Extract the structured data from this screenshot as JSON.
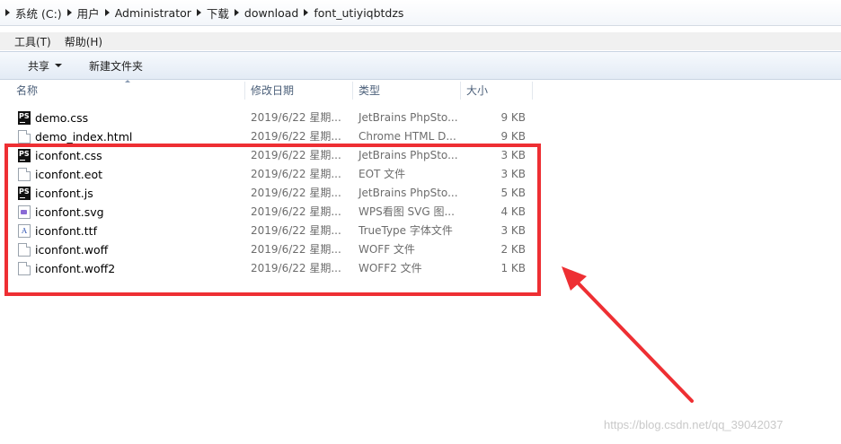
{
  "breadcrumb": [
    "系统 (C:)",
    "用户",
    "Administrator",
    "下载",
    "download",
    "font_utiyiqbtdzs"
  ],
  "menu": {
    "tools": "工具(T)",
    "help": "帮助(H)"
  },
  "toolbar": {
    "share": "共享",
    "new_folder": "新建文件夹"
  },
  "columns": {
    "name": "名称",
    "date": "修改日期",
    "type": "类型",
    "size": "大小"
  },
  "files": [
    {
      "name": "demo.css",
      "date": "2019/6/22 星期...",
      "type": "JetBrains PhpSto...",
      "size": "9 KB",
      "icon": "phpstorm-icon"
    },
    {
      "name": "demo_index.html",
      "date": "2019/6/22 星期...",
      "type": "Chrome HTML D...",
      "size": "9 KB",
      "icon": "file-icon"
    },
    {
      "name": "iconfont.css",
      "date": "2019/6/22 星期...",
      "type": "JetBrains PhpSto...",
      "size": "3 KB",
      "icon": "phpstorm-icon"
    },
    {
      "name": "iconfont.eot",
      "date": "2019/6/22 星期...",
      "type": "EOT 文件",
      "size": "3 KB",
      "icon": "file-icon"
    },
    {
      "name": "iconfont.js",
      "date": "2019/6/22 星期...",
      "type": "JetBrains PhpSto...",
      "size": "5 KB",
      "icon": "phpstorm-icon"
    },
    {
      "name": "iconfont.svg",
      "date": "2019/6/22 星期...",
      "type": "WPS看图 SVG 图...",
      "size": "4 KB",
      "icon": "svg-file-icon"
    },
    {
      "name": "iconfont.ttf",
      "date": "2019/6/22 星期...",
      "type": "TrueType 字体文件",
      "size": "3 KB",
      "icon": "font-file-icon"
    },
    {
      "name": "iconfont.woff",
      "date": "2019/6/22 星期...",
      "type": "WOFF 文件",
      "size": "2 KB",
      "icon": "file-icon"
    },
    {
      "name": "iconfont.woff2",
      "date": "2019/6/22 星期...",
      "type": "WOFF2 文件",
      "size": "1 KB",
      "icon": "file-icon"
    }
  ],
  "watermark": "https://blog.csdn.net/qq_39042037",
  "colors": {
    "highlight": "#ee2f33",
    "toolbar": "#e3ebf5"
  }
}
